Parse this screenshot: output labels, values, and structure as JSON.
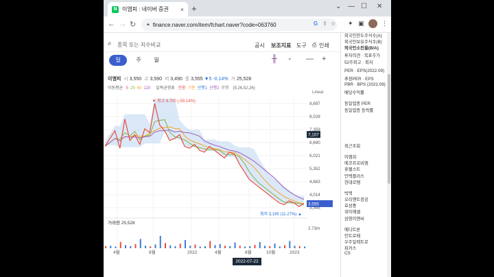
{
  "browser": {
    "tab_title": "이엠피 : 네이버 증권",
    "tab_close": "×",
    "new_tab": "+",
    "url": "finance.naver.com/item/fchart.naver?code=063760",
    "window_controls": [
      "⌄",
      "—",
      "☐",
      "✕"
    ]
  },
  "page": {
    "search_placeholder": "종목 또는 지수비교",
    "links": [
      "공시",
      "보조지표",
      "도구"
    ],
    "print_label": "인쇄",
    "periods": [
      "일",
      "주",
      "월"
    ],
    "active_period": "일"
  },
  "stock": {
    "name": "이엠피",
    "open_label": "시",
    "open": "3,550",
    "high_label": "고",
    "high": "3,590",
    "low_label": "저",
    "low": "3,490",
    "close_label": "종",
    "close": "3,555",
    "change": "▼5 -0.14%",
    "volume_label": "거",
    "volume": "25,528"
  },
  "indicators": {
    "ma_label": "이동평균",
    "ma": [
      {
        "text": "5",
        "color": "#e8505b"
      },
      {
        "text": "20",
        "color": "#7cb342"
      },
      {
        "text": "60",
        "color": "#f5a623"
      },
      {
        "text": "120",
        "color": "#9c5fb5"
      }
    ],
    "ichimoku_label": "일목균형표",
    "ichimoku": [
      {
        "text": "전환",
        "color": "#e8505b"
      },
      {
        "text": "기준",
        "color": "#f5a623"
      },
      {
        "text": "선행1",
        "color": "#3a7bd5"
      },
      {
        "text": "선행2",
        "color": "#9c5fb5"
      },
      {
        "text": "후행",
        "color": "#888888"
      }
    ],
    "params": "(9,26,52,26)"
  },
  "chart_data": {
    "type": "line",
    "scale": "Linear",
    "y_ticks": [
      8697,
      8028,
      7359,
      6690,
      6021,
      5352,
      4683,
      4014,
      3345
    ],
    "y_tick_labels": [
      "8,697",
      "8,028",
      "7,359",
      "6,690",
      "6,021",
      "5,352",
      "4,683",
      "4,014",
      "3,345"
    ],
    "ylim": [
      3000,
      9000
    ],
    "last_price_label": "3,555",
    "ref_price_label": "7,107",
    "max_annotation": "최고 8,700 (-59.14%)",
    "min_annotation": "최저 3,195 (11.27%)",
    "x_tick_labels": [
      "4월",
      "8월",
      "2022",
      "4월",
      "8월",
      "10월",
      "2023"
    ],
    "series": [
      {
        "name": "종",
        "color": "#e74c3c",
        "values": [
          6500,
          6900,
          7300,
          6400,
          7900,
          6800,
          7100,
          6600,
          7400,
          7200,
          8700,
          7600,
          7300,
          6800,
          6900,
          7100,
          6500,
          6400,
          6600,
          6300,
          6200,
          6500,
          6300,
          6100,
          5900,
          6200,
          6100,
          5600,
          5200,
          4800,
          4600,
          4400,
          4200,
          4000,
          3800,
          3600,
          3500,
          3700,
          3600,
          3400,
          3555
        ]
      }
    ],
    "volume": {
      "label": "거래량",
      "value": "25,528",
      "max_label": "2.73m",
      "values": [
        0.1,
        0.12,
        0.08,
        0.3,
        0.15,
        0.1,
        0.2,
        0.45,
        0.12,
        0.09,
        0.18,
        0.6,
        0.25,
        0.14,
        0.1,
        0.22,
        0.4,
        0.12,
        0.18,
        0.08,
        0.1,
        0.35,
        0.15,
        0.2,
        0.12,
        0.1,
        0.28,
        0.12,
        0.08,
        0.1,
        0.16,
        0.3,
        0.12,
        0.1,
        0.22,
        0.09,
        0.15,
        0.35,
        0.12,
        0.1,
        0.08
      ]
    },
    "crosshair_date": "2022-07-22"
  },
  "sidebar": {
    "top_items": [
      "외국인한도주식수(A)",
      "외국인보유주식수(B)",
      "외국인소진율(B/A)"
    ],
    "invest_items": [
      "투자의견 · 목표주가",
      "52주최고 · 최저"
    ],
    "per_items": [
      "PER · EPS(2022.09)",
      "추정PER · EPS",
      "PBR · BPS (2022.09)",
      "배당수익률"
    ],
    "industry_items": [
      "동일업종 PER",
      "동일업종 등락률"
    ],
    "recent_header": "최근조회",
    "recent_items": [
      "이엠피",
      "에코프로비엠",
      "휴젤스트",
      "인텍플러스",
      "현대로템",
      "빅텍",
      "오리엔트정공",
      "효성중",
      "위이에셀",
      "삼영이엔씨",
      "에디트론",
      "인트로메",
      "우주일렉트로",
      "피커스",
      "CS"
    ]
  }
}
